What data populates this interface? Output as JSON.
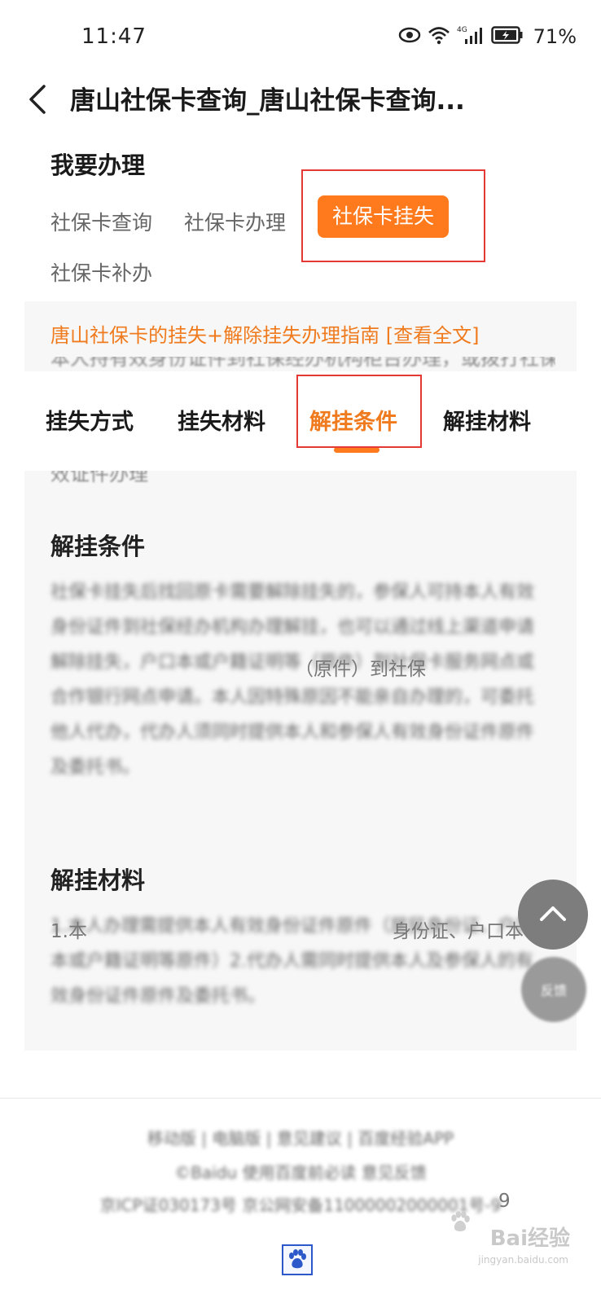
{
  "status_bar": {
    "time": "11:47",
    "network": "4G",
    "battery": "71%"
  },
  "header": {
    "title": "唐山社保卡查询_唐山社保卡查询..."
  },
  "service": {
    "heading": "我要办理",
    "options": [
      {
        "label": "社保卡查询",
        "active": false
      },
      {
        "label": "社保卡办理",
        "active": false
      },
      {
        "label": "社保卡挂失",
        "active": true
      },
      {
        "label": "社保卡补办",
        "active": false
      }
    ]
  },
  "guide": {
    "link": "唐山社保卡的挂失+解除挂失办理指南 [查看全文]",
    "cut_line_top": "本人持有效身份证件到社保经办机构柜台办理，或拨打社保服务热线挂失",
    "cut_line_bottom": "效证件办理"
  },
  "tabs": [
    {
      "label": "挂失方式",
      "active": false
    },
    {
      "label": "挂失材料",
      "active": false
    },
    {
      "label": "解挂条件",
      "active": true
    },
    {
      "label": "解挂材料",
      "active": false
    }
  ],
  "sections": {
    "unlock_conditions": {
      "heading": "解挂条件",
      "blurred_text": "社保卡挂失后找回原卡需要解除挂失的，参保人可持本人有效身份证件到社保经办机构办理解挂，也可以通过线上渠道申请解除挂失，户口本或户籍证明等（原件）到社保卡服务网点或合作银行网点申请。本人因特殊原因不能亲自办理的，可委托他人代办，代办人须同时提供本人和参保人有效身份证件原件及委托书。",
      "peek_text": "（原件）到社保"
    },
    "unlock_materials": {
      "heading": "解挂材料",
      "blurred_text": "1.本人办理需提供本人有效身份证件原件（居民身份证、户口本或户籍证明等原件）2.代办人需同时提供本人及参保人的有效身份证件原件及委托书。",
      "peek_text_1": "1.本",
      "peek_text_2": "身份证、户口本"
    }
  },
  "footer": {
    "line1": "移动版 | 电脑版 | 意见建议 | 百度经验APP",
    "line2": "©Baidu 使用百度前必读 意见反馈",
    "line3": "京ICP证030173号 京公网安备11000002000001号-9",
    "peek_9": "9"
  },
  "watermark": {
    "text": "Bai经验",
    "sub": "jingyan.baidu.com"
  },
  "fab": {
    "second_label": "反馈"
  }
}
